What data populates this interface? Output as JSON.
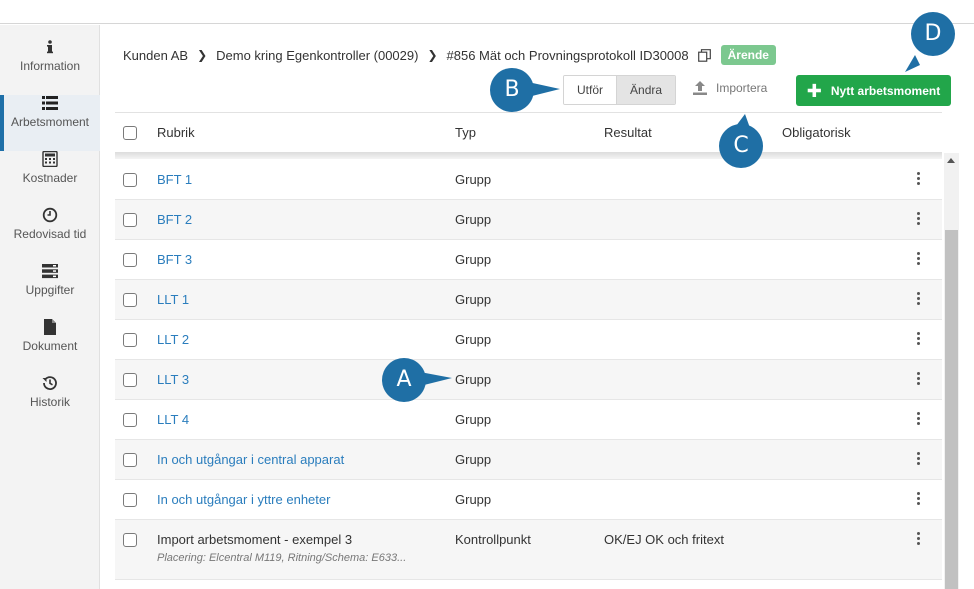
{
  "sidebar": {
    "items": [
      {
        "label": "Information",
        "icon": "info-icon"
      },
      {
        "label": "Arbetsmoment",
        "icon": "list-icon",
        "active": true
      },
      {
        "label": "Kostnader",
        "icon": "calculator-icon"
      },
      {
        "label": "Redovisad tid",
        "icon": "clock-icon"
      },
      {
        "label": "Uppgifter",
        "icon": "tasks-icon"
      },
      {
        "label": "Dokument",
        "icon": "document-icon"
      },
      {
        "label": "Historik",
        "icon": "history-icon"
      }
    ]
  },
  "breadcrumb": {
    "customer": "Kunden AB",
    "project": "Demo kring Egenkontroller (00029)",
    "protocol": "#856 Mät och Provningsprotokoll ID30008",
    "badge": "Ärende"
  },
  "toolbar": {
    "mode_perform": "Utför",
    "mode_edit": "Ändra",
    "import_label": "Importera",
    "new_label": "Nytt arbetsmoment"
  },
  "table": {
    "headers": {
      "rubrik": "Rubrik",
      "typ": "Typ",
      "resultat": "Resultat",
      "obligatorisk": "Obligatorisk"
    },
    "rows": [
      {
        "rubrik": "BFT 1",
        "typ": "Grupp",
        "resultat": "",
        "link": true
      },
      {
        "rubrik": "BFT 2",
        "typ": "Grupp",
        "resultat": "",
        "link": true
      },
      {
        "rubrik": "BFT 3",
        "typ": "Grupp",
        "resultat": "",
        "link": true
      },
      {
        "rubrik": "LLT 1",
        "typ": "Grupp",
        "resultat": "",
        "link": true
      },
      {
        "rubrik": "LLT 2",
        "typ": "Grupp",
        "resultat": "",
        "link": true
      },
      {
        "rubrik": "LLT 3",
        "typ": "Grupp",
        "resultat": "",
        "link": true
      },
      {
        "rubrik": "LLT 4",
        "typ": "Grupp",
        "resultat": "",
        "link": true
      },
      {
        "rubrik": "In och utgångar i central apparat",
        "typ": "Grupp",
        "resultat": "",
        "link": true
      },
      {
        "rubrik": "In och utgångar i yttre enheter",
        "typ": "Grupp",
        "resultat": "",
        "link": true
      },
      {
        "rubrik": "Import arbetsmoment - exempel 3",
        "sub": "Placering: Elcentral M119, Ritning/Schema: E633...",
        "typ": "Kontrollpunkt",
        "resultat": "OK/EJ OK och fritext",
        "link": false
      }
    ]
  },
  "callouts": {
    "a": "A",
    "b": "B",
    "c": "C",
    "d": "D"
  },
  "colors": {
    "accent": "#1e6fa8",
    "primary_button": "#22a64a",
    "badge": "#7cc88f",
    "link": "#2a7dbd",
    "callout": "#1f6fa5"
  }
}
